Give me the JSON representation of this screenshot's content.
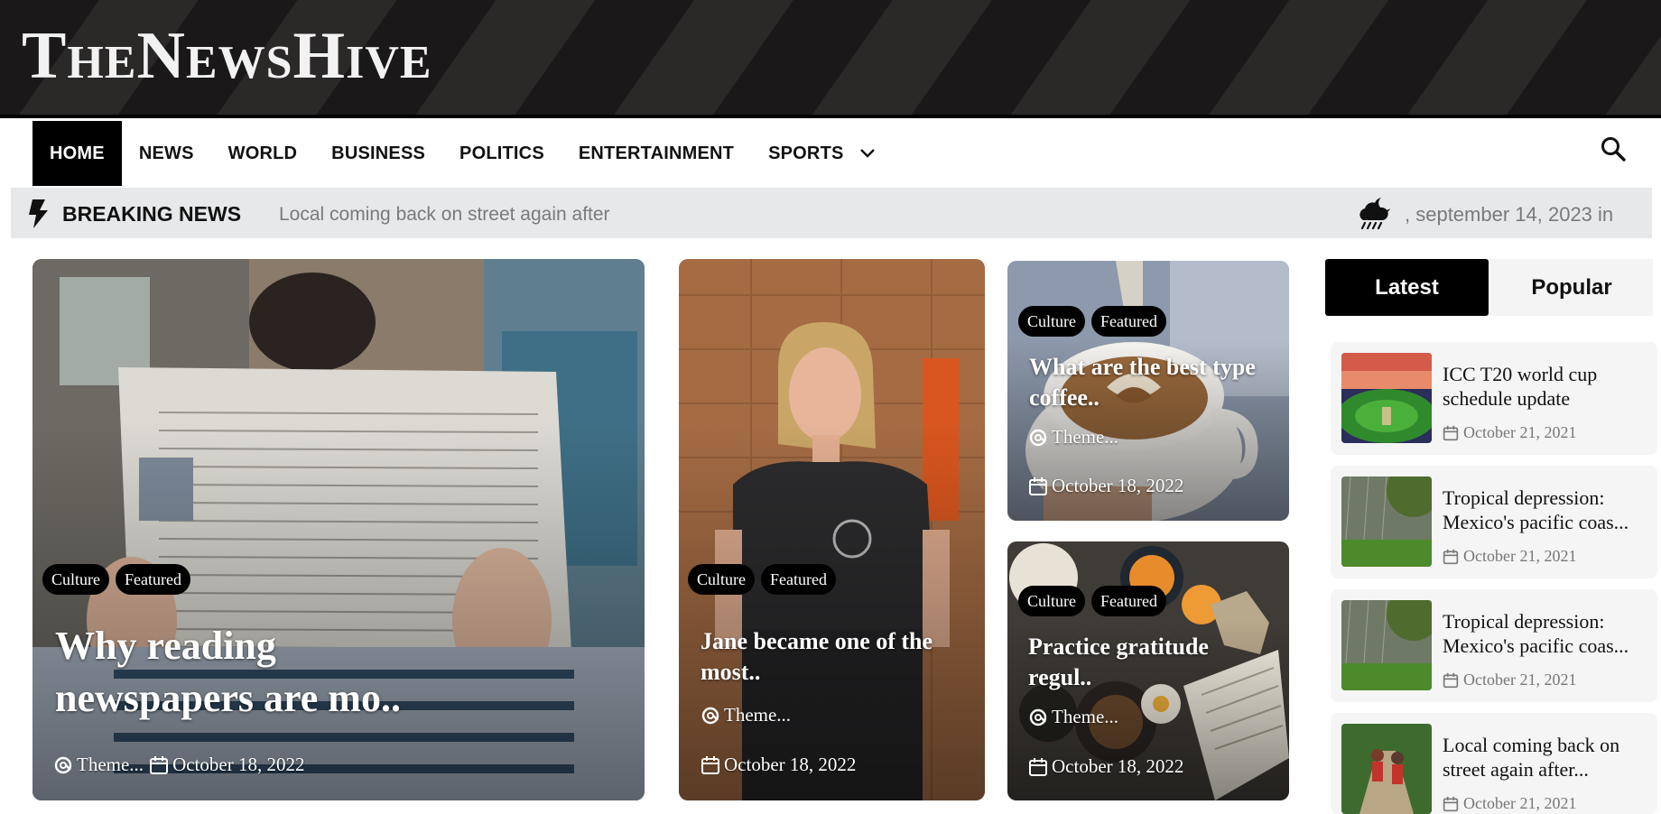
{
  "site": {
    "logo": "TheNewsHive"
  },
  "nav": {
    "items": [
      "HOME",
      "NEWS",
      "WORLD",
      "BUSINESS",
      "POLITICS",
      "ENTERTAINMENT",
      "SPORTS"
    ],
    "active": "HOME",
    "search_icon": "search-icon",
    "dropdown_icon": "chevron-down-icon"
  },
  "breaking": {
    "label": "BREAKING NEWS",
    "ticker": "Local coming back on street again after",
    "weather_icon": "night-rain-cloud-icon",
    "dateline": ", september 14, 2023 in"
  },
  "cards": [
    {
      "tags": [
        "Culture",
        "Featured"
      ],
      "title": "Why reading newspapers are mo..",
      "author": "Theme...",
      "date": "October 18, 2022"
    },
    {
      "tags": [
        "Culture",
        "Featured"
      ],
      "title": "Jane became one of the most..",
      "author": "Theme...",
      "date": "October 18, 2022"
    },
    {
      "tags": [
        "Culture",
        "Featured"
      ],
      "title": "What are the best type coffee..",
      "author": "Theme...",
      "date": "October 18, 2022"
    },
    {
      "tags": [
        "Culture",
        "Featured"
      ],
      "title": "Practice gratitude regul..",
      "author": "Theme...",
      "date": "October 18, 2022"
    }
  ],
  "sidebar": {
    "tabs": [
      "Latest",
      "Popular"
    ],
    "active_tab": "Latest",
    "items": [
      {
        "title": "ICC T20 world cup schedule update",
        "date": "October 21, 2021"
      },
      {
        "title": "Tropical depression: Mexico's pacific coas...",
        "date": "October 21, 2021"
      },
      {
        "title": "Tropical depression: Mexico's pacific coas...",
        "date": "October 21, 2021"
      },
      {
        "title": "Local coming back on street again after...",
        "date": "October 21, 2021"
      }
    ]
  },
  "colors": {
    "accent": "#000000",
    "breaking_bg": "#e6e8ea",
    "muted_text": "#7a7a7a"
  }
}
